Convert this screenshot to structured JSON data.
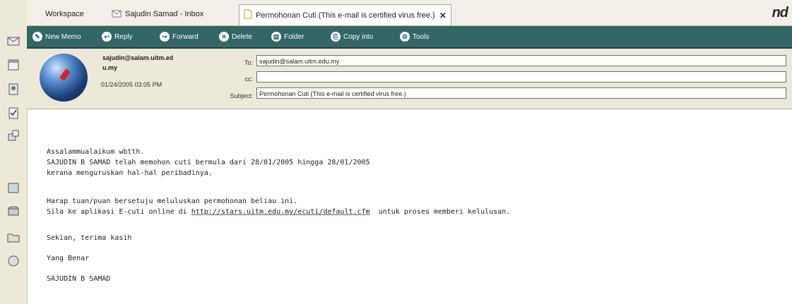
{
  "tabs": [
    {
      "label": "Workspace",
      "icon": "workspace-icon"
    },
    {
      "label": "Sajudin Samad - Inbox",
      "icon": "inbox-icon"
    },
    {
      "label": "Permohonan Cuti (This e-mail is certified virus free.)",
      "icon": "document-icon"
    }
  ],
  "brand": "nd",
  "toolbar": {
    "new_memo": "New Memo",
    "reply": "Reply",
    "forward": "Forward",
    "delete": "Delete",
    "folder": "Folder",
    "copy_into": "Copy into",
    "tools": "Tools"
  },
  "header": {
    "sender_line1": "sajudin@salam.uitm.ed",
    "sender_line2": "u.my",
    "date": "01/24/2005 03:05 PM",
    "to_label": "To:",
    "to_value": "sajudin@salam.uitm.edu.my",
    "cc_label": "cc:",
    "cc_value": "",
    "subject_label": "Subject:",
    "subject_value": "Permohonan Cuti (This e-mail is certified virus free.)"
  },
  "body": {
    "l1": "Assalammualaikum wbtth.",
    "l2": "SAJUDIN B SAMAD telah memohon cuti bermula dari 28/01/2005 hingga 28/01/2005",
    "l3": "kerana menguruskan hal-hal peribadinya.",
    "l4": "Harap tuan/puan bersetuju meluluskan permohonan beliau ini.",
    "l5a": "Sila ke aplikasi E-cuti online di ",
    "l5link": "http://stars.uitm.edu.my/ecuti/default.cfm",
    "l5b": "  untuk proses memberi kelulusan.",
    "l6": "Sekian, terima kasih",
    "l7": "Yang Benar",
    "l8": "SAJUDIN B SAMAD"
  }
}
